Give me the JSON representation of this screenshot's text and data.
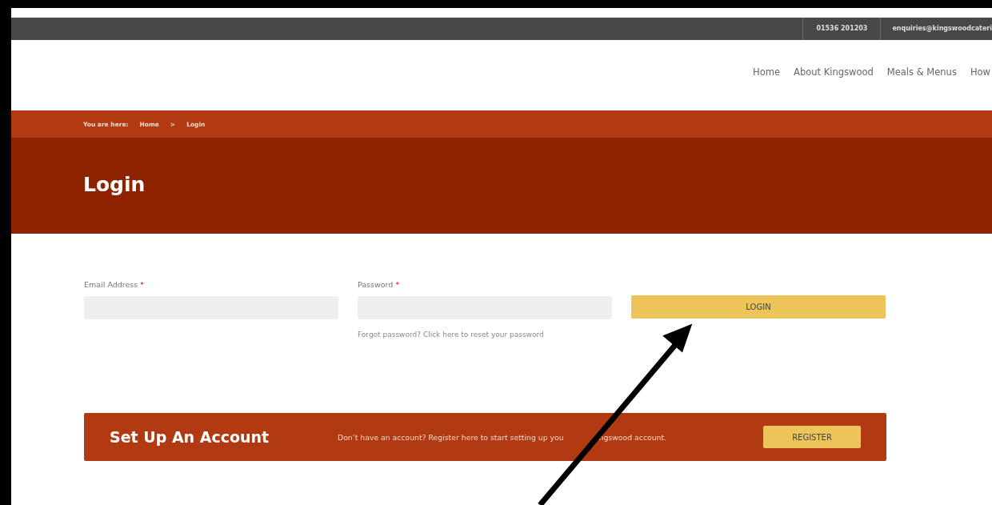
{
  "top_bar": {
    "phone": "01536 201203",
    "email": "enquiries@kingswoodcateri"
  },
  "nav": [
    "Home",
    "About Kingswood",
    "Meals & Menus",
    "How"
  ],
  "breadcrumb": {
    "prefix": "You are here:",
    "items": [
      "Home",
      "Login"
    ],
    "separator": ">"
  },
  "page_title": "Login",
  "form": {
    "fields": [
      {
        "label": "Email Address",
        "required_mark": "*"
      },
      {
        "label": "Password",
        "required_mark": "*"
      }
    ],
    "login_button": "LOGIN",
    "forgot_link": "Forgot password? Click here to reset your password"
  },
  "register_banner": {
    "title": "Set Up An Account",
    "text_parts": [
      "Don’t have an account? Register here to start setting up you",
      "ngswood account."
    ],
    "button": "REGISTER"
  }
}
